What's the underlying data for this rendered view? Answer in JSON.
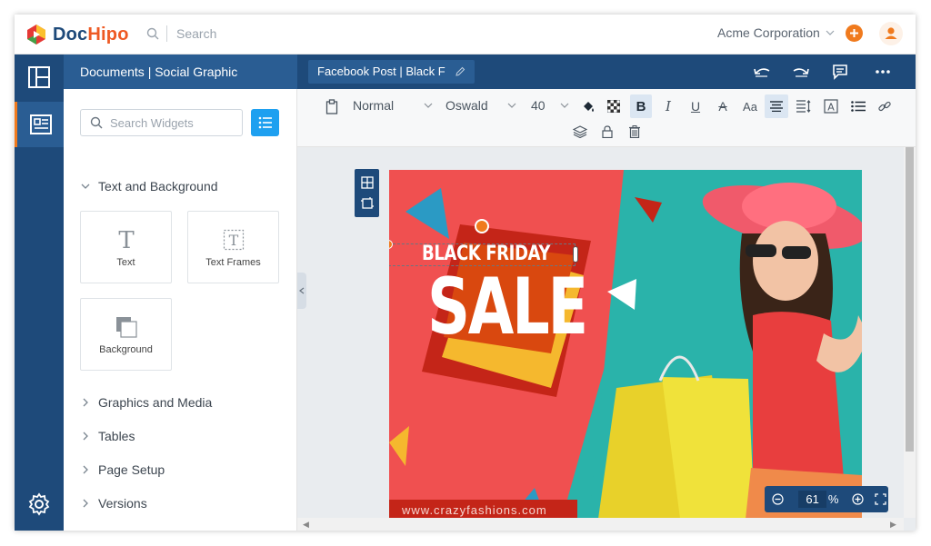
{
  "app": {
    "logo_name": "DocHipo",
    "logo_part1": "Doc",
    "logo_part2": "Hipo",
    "search_placeholder": "Search",
    "org_name": "Acme Corporation"
  },
  "panel": {
    "title": "Documents | Social Graphic",
    "widget_search_placeholder": "Search Widgets",
    "sections": [
      {
        "label": "Text and Background",
        "expanded": true
      },
      {
        "label": "Graphics and Media",
        "expanded": false
      },
      {
        "label": "Tables",
        "expanded": false
      },
      {
        "label": "Page Setup",
        "expanded": false
      },
      {
        "label": "Versions",
        "expanded": false
      }
    ],
    "tiles": [
      {
        "label": "Text",
        "icon": "text-icon"
      },
      {
        "label": "Text Frames",
        "icon": "text-frame-icon"
      },
      {
        "label": "Background",
        "icon": "background-icon"
      }
    ]
  },
  "document": {
    "tab_title": "Facebook Post | Black F"
  },
  "toolbar": {
    "style_value": "Normal",
    "font_value": "Oswald",
    "size_value": "40",
    "bold_label": "B",
    "italic_label": "I",
    "underline_label": "U",
    "strike_label": "A",
    "case_label": "Aa"
  },
  "design": {
    "headline": "BLACK FRIDAY",
    "sale": "SALE",
    "url": "www.crazyfashions.com"
  },
  "zoom": {
    "value": "61",
    "unit": "%"
  },
  "colors": {
    "navy": "#1e4a7a",
    "accent_orange": "#f07a1d",
    "design_red": "#f05050",
    "design_teal": "#2ab3aa",
    "design_yellow": "#f5b82e",
    "design_dark_red": "#c42518"
  }
}
